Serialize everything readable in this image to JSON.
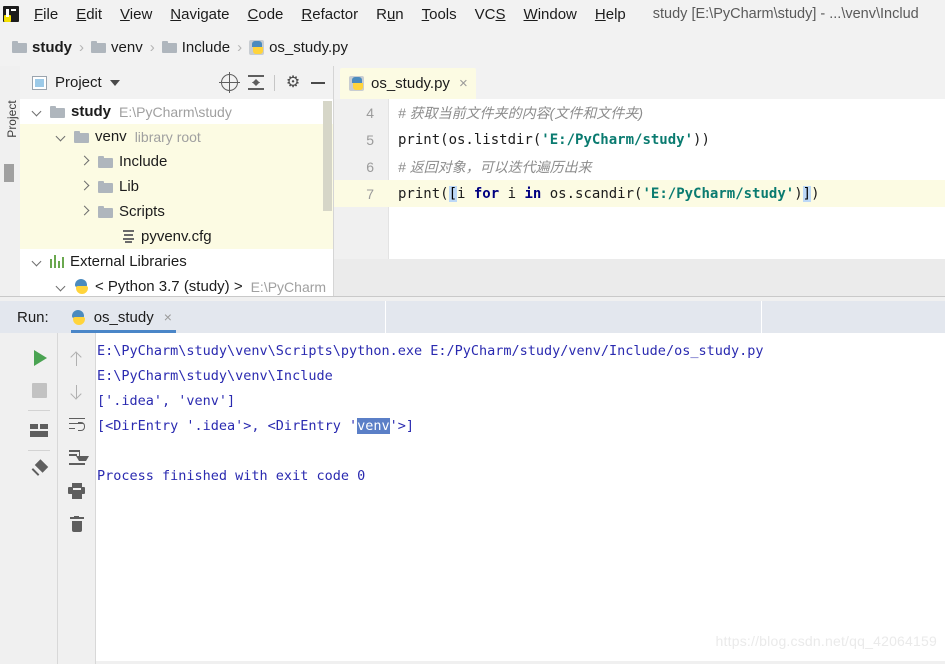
{
  "window": {
    "title": "study [E:\\PyCharm\\study] - ...\\venv\\Includ",
    "logo": "pycharm-logo"
  },
  "menubar": {
    "items": [
      {
        "label": "File",
        "mnemonic": "F"
      },
      {
        "label": "Edit",
        "mnemonic": "E"
      },
      {
        "label": "View",
        "mnemonic": "V"
      },
      {
        "label": "Navigate",
        "mnemonic": "N"
      },
      {
        "label": "Code",
        "mnemonic": "C"
      },
      {
        "label": "Refactor",
        "mnemonic": "R"
      },
      {
        "label": "Run",
        "mnemonic": "u"
      },
      {
        "label": "Tools",
        "mnemonic": "T"
      },
      {
        "label": "VCS",
        "mnemonic": "S"
      },
      {
        "label": "Window",
        "mnemonic": "W"
      },
      {
        "label": "Help",
        "mnemonic": "H"
      }
    ]
  },
  "breadcrumb": {
    "separator": "›",
    "items": [
      {
        "label": "study",
        "icon": "folder-icon",
        "bold": true
      },
      {
        "label": "venv",
        "icon": "folder-icon",
        "bold": false
      },
      {
        "label": "Include",
        "icon": "folder-icon",
        "bold": false
      },
      {
        "label": "os_study.py",
        "icon": "python-file-icon",
        "bold": false
      }
    ]
  },
  "left_strip": {
    "tab_label": "Project"
  },
  "project_panel": {
    "title": "Project",
    "toolbar": [
      {
        "name": "locate-icon"
      },
      {
        "name": "collapse-all-icon"
      },
      {
        "name": "gear-icon"
      },
      {
        "name": "minimize-icon"
      }
    ],
    "tree": [
      {
        "label": "study",
        "sub": "E:\\PyCharm\\study",
        "icon": "folder-icon",
        "arrow": "down",
        "indent": 12,
        "bold": true,
        "highlight": false
      },
      {
        "label": "venv",
        "sub": "library root",
        "icon": "folder-icon",
        "arrow": "down",
        "indent": 36,
        "bold": false,
        "highlight": true
      },
      {
        "label": "Include",
        "sub": "",
        "icon": "folder-icon",
        "arrow": "right",
        "indent": 60,
        "bold": false,
        "highlight": true
      },
      {
        "label": "Lib",
        "sub": "",
        "icon": "folder-icon",
        "arrow": "right",
        "indent": 60,
        "bold": false,
        "highlight": true
      },
      {
        "label": "Scripts",
        "sub": "",
        "icon": "folder-icon",
        "arrow": "right",
        "indent": 60,
        "bold": false,
        "highlight": true
      },
      {
        "label": "pyvenv.cfg",
        "sub": "",
        "icon": "config-file-icon",
        "arrow": "none",
        "indent": 84,
        "bold": false,
        "highlight": true
      },
      {
        "label": "External Libraries",
        "sub": "",
        "icon": "library-icon",
        "arrow": "down",
        "indent": 12,
        "bold": false,
        "highlight": false
      },
      {
        "label": "< Python 3.7 (study) >",
        "sub": "E:\\PyCharm",
        "icon": "python-icon",
        "arrow": "down",
        "indent": 36,
        "bold": false,
        "highlight": false
      }
    ]
  },
  "editor": {
    "tab": {
      "label": "os_study.py",
      "icon": "python-file-icon",
      "close": "×"
    },
    "lines": [
      {
        "no": "4",
        "current": false,
        "tokens": [
          {
            "t": "comment",
            "v": "# 获取当前文件夹的内容(文件和文件夹)"
          }
        ]
      },
      {
        "no": "5",
        "current": false,
        "tokens": [
          {
            "t": "plain",
            "v": "print(os.listdir("
          },
          {
            "t": "string",
            "v": "'E:/PyCharm/study'"
          },
          {
            "t": "plain",
            "v": "))"
          }
        ]
      },
      {
        "no": "6",
        "current": false,
        "tokens": [
          {
            "t": "comment",
            "v": "# 返回对象，可以迭代遍历出来"
          }
        ]
      },
      {
        "no": "7",
        "current": true,
        "tokens": [
          {
            "t": "plain",
            "v": "print("
          },
          {
            "t": "bracket",
            "v": "["
          },
          {
            "t": "plain",
            "v": "i "
          },
          {
            "t": "keyword",
            "v": "for"
          },
          {
            "t": "plain",
            "v": " i "
          },
          {
            "t": "keyword",
            "v": "in"
          },
          {
            "t": "plain",
            "v": " os.scandir("
          },
          {
            "t": "string",
            "v": "'E:/PyCharm/study'"
          },
          {
            "t": "plain",
            "v": ")"
          },
          {
            "t": "bracket",
            "v": "]"
          },
          {
            "t": "plain",
            "v": ")"
          }
        ]
      }
    ]
  },
  "run_panel": {
    "label": "Run:",
    "tab": {
      "label": "os_study",
      "icon": "python-icon",
      "close": "×"
    },
    "toolbar_left": [
      {
        "name": "run-icon"
      },
      {
        "name": "stop-icon"
      },
      {
        "name": "layout-icon"
      },
      {
        "name": "pin-icon"
      }
    ],
    "toolbar_right": [
      {
        "name": "up-arrow-icon"
      },
      {
        "name": "down-arrow-icon"
      },
      {
        "name": "soft-wrap-icon"
      },
      {
        "name": "scroll-to-end-icon"
      },
      {
        "name": "print-icon"
      },
      {
        "name": "trash-icon"
      }
    ],
    "console": [
      {
        "segments": [
          {
            "t": "text",
            "v": "E:\\PyCharm\\study\\venv\\Scripts\\python.exe E:/PyCharm/study/venv/Include/os_study.py"
          }
        ]
      },
      {
        "segments": [
          {
            "t": "text",
            "v": "E:\\PyCharm\\study\\venv\\Include"
          }
        ]
      },
      {
        "segments": [
          {
            "t": "text",
            "v": "['.idea', 'venv']"
          }
        ]
      },
      {
        "segments": [
          {
            "t": "text",
            "v": "[<DirEntry '.idea'>, <DirEntry '"
          },
          {
            "t": "selected",
            "v": "venv"
          },
          {
            "t": "text",
            "v": "'>]"
          }
        ]
      },
      {
        "segments": [
          {
            "t": "text",
            "v": ""
          }
        ]
      },
      {
        "segments": [
          {
            "t": "text",
            "v": "Process finished with exit code 0"
          }
        ]
      }
    ]
  },
  "watermark": "https://blog.csdn.net/qq_42064159",
  "colors": {
    "accent_blue": "#4a86c8",
    "console_text": "#2a2ab0",
    "selection": "#5b7fc7",
    "string": "#0a7b70",
    "keyword": "#000080",
    "comment": "#8c8c8c",
    "current_line": "#fcfbe3",
    "tree_highlight": "#fcfbe3",
    "run_header_bg": "#e3e7ee"
  }
}
